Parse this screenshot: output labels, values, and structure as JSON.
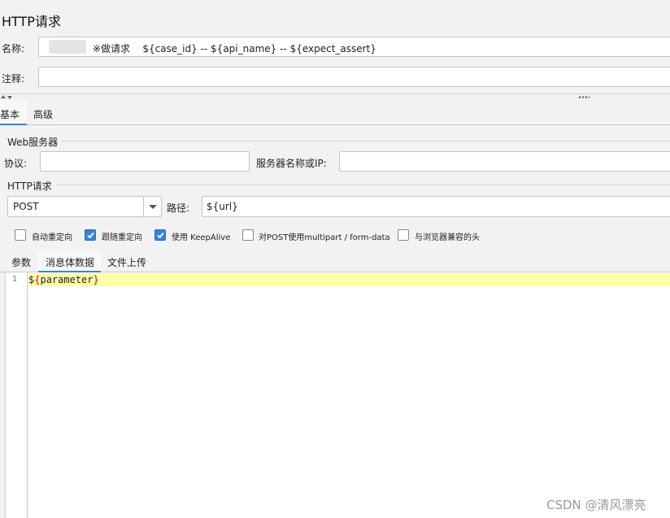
{
  "panel": {
    "title": "HTTP请求"
  },
  "name_row": {
    "label": "名称:",
    "value": "※做请求    ${case_id} -- ${api_name} -- ${expect_assert}"
  },
  "comment_row": {
    "label": "注释:",
    "value": ""
  },
  "tabs": {
    "basic": "基本",
    "advanced": "高级"
  },
  "web_server": {
    "legend": "Web服务器",
    "protocol_label": "协议:",
    "protocol_value": "",
    "server_label": "服务器名称或IP:",
    "server_value": ""
  },
  "http_request": {
    "legend": "HTTP请求",
    "method": "POST",
    "path_label": "路径:",
    "path_value": "${url}"
  },
  "options": [
    {
      "label": "自动重定向",
      "checked": false
    },
    {
      "label": "跟随重定向",
      "checked": true
    },
    {
      "label": "使用 KeepAlive",
      "checked": true
    },
    {
      "label": "对POST使用multipart / form-data",
      "checked": false
    },
    {
      "label": "与浏览器兼容的头",
      "checked": false
    }
  ],
  "subtabs": {
    "params": "参数",
    "body": "消息体数据",
    "files": "文件上传"
  },
  "editor": {
    "line_number": "1",
    "dollar": "$",
    "brace_open": "{",
    "variable": "parameter",
    "brace_close": "}"
  },
  "watermark": "CSDN @清风漂亮",
  "colors": {
    "accent": "#3b82d4",
    "highlight": "#ffffaa",
    "brace": "#d0021b"
  }
}
